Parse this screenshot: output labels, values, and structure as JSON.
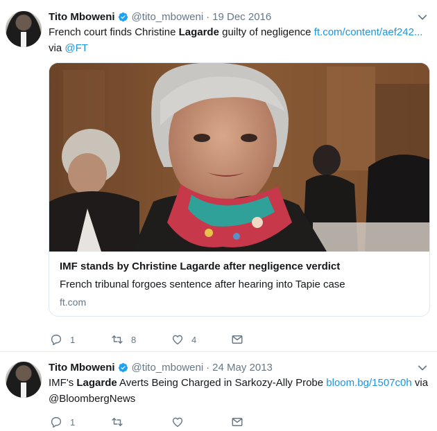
{
  "tweets": [
    {
      "name": "Tito Mboweni",
      "handle": "@tito_mboweni",
      "date": "19 Dec 2016",
      "text_before": "French court finds Christine ",
      "text_bold": "Lagarde",
      "text_after": " guilty of negligence ",
      "link": "ft.com/content/aef242...",
      "text_line2_prefix": "via ",
      "mention": "@FT",
      "card": {
        "title": "IMF stands by Christine Lagarde after negligence verdict",
        "description": "French tribunal forgoes sentence after hearing into Tapie case",
        "domain": "ft.com"
      },
      "actions": {
        "replies": "1",
        "retweets": "8",
        "likes": "4"
      }
    },
    {
      "name": "Tito Mboweni",
      "handle": "@tito_mboweni",
      "date": "24 May 2013",
      "text_before": "IMF's ",
      "text_bold": "Lagarde",
      "text_after": " Averts Being Charged in Sarkozy-Ally Probe ",
      "link": "bloom.bg/1507c0h",
      "text_line1_suffix": " via",
      "mention": "@BloombergNews",
      "actions": {
        "replies": "1",
        "retweets": "",
        "likes": ""
      }
    }
  ],
  "colors": {
    "link": "#1b95e0",
    "secondary_text": "#657786",
    "verified": "#1da1f2",
    "border": "#e6ecf0"
  },
  "icons": [
    "verified-badge-icon",
    "chevron-down-icon",
    "reply-icon",
    "retweet-icon",
    "like-heart-icon",
    "direct-message-icon"
  ]
}
